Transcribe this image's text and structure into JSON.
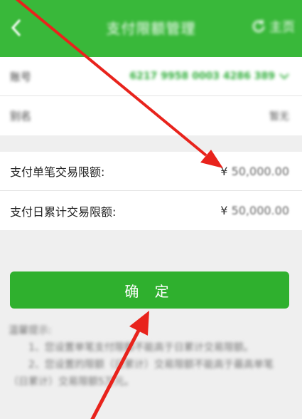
{
  "header": {
    "title": "支付限额管理",
    "home_label": "主页"
  },
  "account": {
    "account_label": "账号",
    "account_value": "6217 9958 0003 4286 389",
    "type_label": "别名",
    "type_value": "暂无"
  },
  "limits": {
    "single_label": "支付单笔交易限额:",
    "single_currency": "¥",
    "single_value": "50,000.00",
    "daily_label": "支付日累计交易限额:",
    "daily_currency": "¥",
    "daily_value": "50,000.00"
  },
  "confirm_label": "确 定",
  "tips": {
    "title": "温馨提示:",
    "line1": "1、您设置单笔支付限额不能高于日累计交易限额。",
    "line2": "2、您设置的限额（日累计）交易限额不能高于最高单笔（日累计）交易限额5万元。"
  },
  "colors": {
    "header_green": "#39b83a",
    "button_green": "#2fb02e",
    "arrow_red": "#e8231c"
  }
}
